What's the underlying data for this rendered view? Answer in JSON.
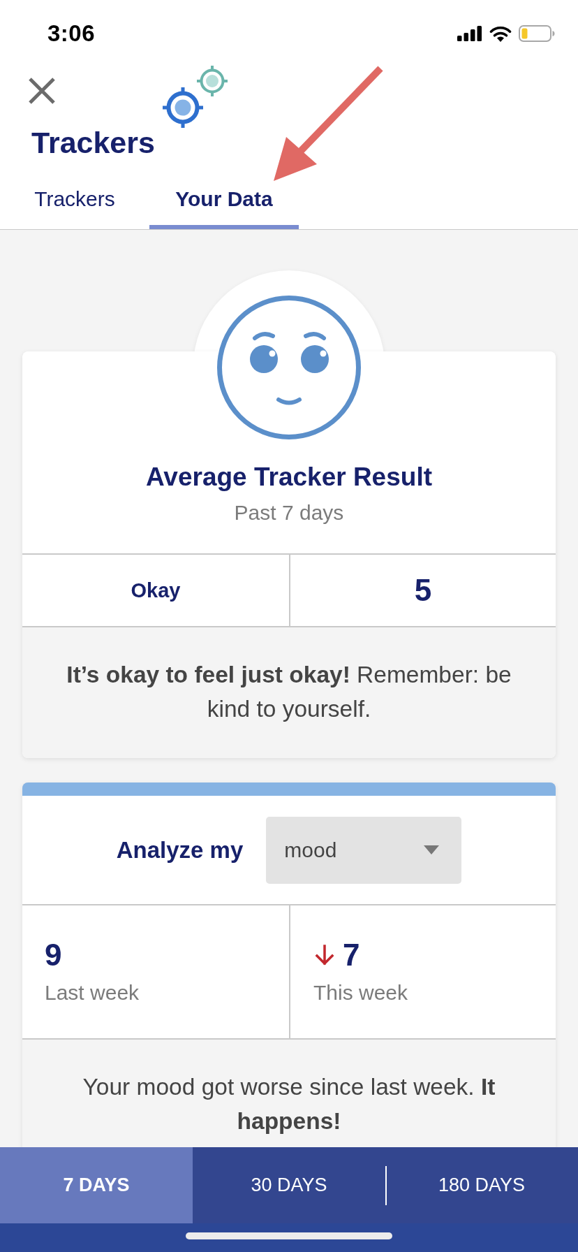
{
  "status_bar": {
    "time": "3:06"
  },
  "header": {
    "title": "Trackers"
  },
  "tabs": [
    {
      "label": "Trackers",
      "selected": false
    },
    {
      "label": "Your Data",
      "selected": true
    }
  ],
  "summary_card": {
    "title": "Average Tracker Result",
    "subtitle": "Past 7 days",
    "result_label": "Okay",
    "result_value": "5",
    "message": "**It’s okay to feel just okay!** Remember: be kind to yourself."
  },
  "analyze_card": {
    "label": "Analyze my",
    "dropdown": {
      "value": "mood"
    },
    "stats": [
      {
        "value": "9",
        "label": "Last week",
        "decreased": false
      },
      {
        "value": "7",
        "label": "This week",
        "decreased": true
      }
    ],
    "message": "Your mood got worse since last week. **It happens!**"
  },
  "range_tabs": [
    {
      "label": "7 DAYS",
      "selected": true
    },
    {
      "label": "30 DAYS",
      "selected": false
    },
    {
      "label": "180 DAYS",
      "selected": false
    }
  ]
}
